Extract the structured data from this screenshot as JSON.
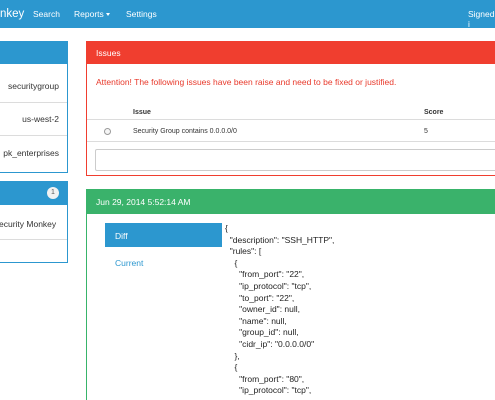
{
  "navbar": {
    "brand": "nkey",
    "links": [
      "Search",
      "Reports",
      "Settings"
    ],
    "signed_in": "Signed i"
  },
  "left_panel_1": {
    "rows": [
      "securitygroup",
      "us-west-2",
      "pk_enterprises"
    ]
  },
  "left_panel_2": {
    "badge": "1",
    "item": "ecurity Monkey"
  },
  "issues": {
    "title": "Issues",
    "attention": "Attention! The following issues have been raise and need to be fixed or justified.",
    "columns": [
      "Issue",
      "Score"
    ],
    "rows": [
      {
        "issue": "Security Group contains 0.0.0.0/0",
        "score": "5"
      }
    ],
    "justification_value": ""
  },
  "revision": {
    "date": "Jun 29, 2014 5:52:14 AM",
    "tabs": [
      "Diff",
      "Current"
    ],
    "code": "{\n  \"description\": \"SSH_HTTP\",\n  \"rules\": [\n    {\n      \"from_port\": \"22\",\n      \"ip_protocol\": \"tcp\",\n      \"to_port\": \"22\",\n      \"owner_id\": null,\n      \"name\": null,\n      \"group_id\": null,\n      \"cidr_ip\": \"0.0.0.0/0\"\n    },\n    {\n      \"from_port\": \"80\",\n      \"ip_protocol\": \"tcp\","
  },
  "colors": {
    "nav_blue": "#2c97cf",
    "issues_red": "#f03e2f",
    "revision_green": "#3ab26b"
  }
}
